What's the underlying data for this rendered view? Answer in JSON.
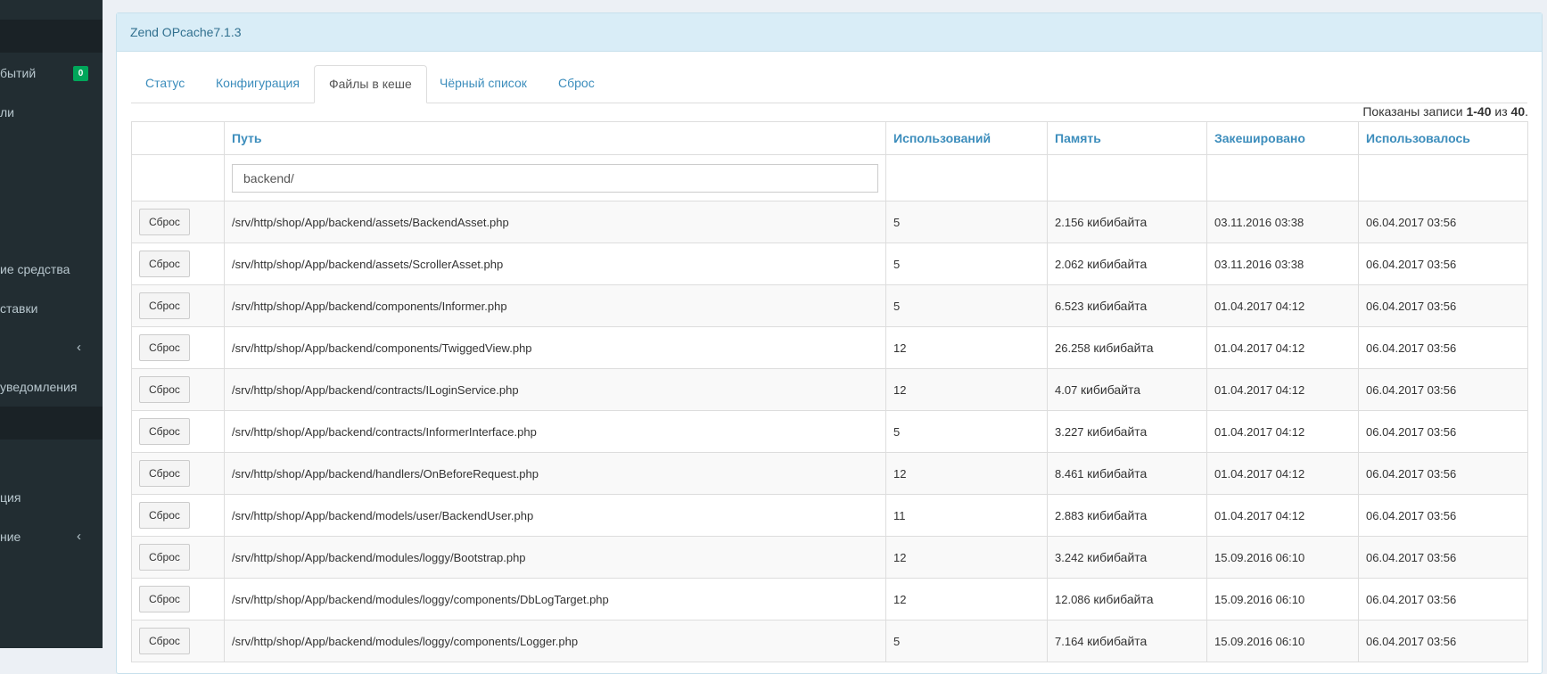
{
  "sidebar": {
    "items": [
      {
        "label": "бытий",
        "badge": "0"
      },
      {
        "label": "ли"
      },
      {
        "label": "ие средства"
      },
      {
        "label": "ставки"
      },
      {
        "label": ""
      },
      {
        "label": "уведомления"
      },
      {
        "label": "ция"
      },
      {
        "label": "ние"
      }
    ],
    "chevron": "‹"
  },
  "header": {
    "title": "Zend OPcache7.1.3"
  },
  "tabs": [
    {
      "label": "Статус"
    },
    {
      "label": "Конфигурация"
    },
    {
      "label": "Файлы в кеше"
    },
    {
      "label": "Чёрный список"
    },
    {
      "label": "Сброс"
    }
  ],
  "summary": {
    "prefix": "Показаны записи ",
    "range": "1-40",
    "mid": " из ",
    "total": "40",
    "suffix": "."
  },
  "table": {
    "columns": [
      "",
      "Путь",
      "Использований",
      "Память",
      "Закешировано",
      "Использовалось"
    ],
    "filter_value": "backend/",
    "reset_label": "Сброс",
    "rows": [
      {
        "path": "/srv/http/shop/App/backend/assets/BackendAsset.php",
        "uses": "5",
        "mem": "2.156",
        "unit": "кибибайта",
        "cached": "03.11.2016 03:38",
        "used": "06.04.2017 03:56"
      },
      {
        "path": "/srv/http/shop/App/backend/assets/ScrollerAsset.php",
        "uses": "5",
        "mem": "2.062",
        "unit": "кибибайта",
        "cached": "03.11.2016 03:38",
        "used": "06.04.2017 03:56"
      },
      {
        "path": "/srv/http/shop/App/backend/components/Informer.php",
        "uses": "5",
        "mem": "6.523",
        "unit": "кибибайта",
        "cached": "01.04.2017 04:12",
        "used": "06.04.2017 03:56"
      },
      {
        "path": "/srv/http/shop/App/backend/components/TwiggedView.php",
        "uses": "12",
        "mem": "26.258",
        "unit": "кибибайта",
        "cached": "01.04.2017 04:12",
        "used": "06.04.2017 03:56"
      },
      {
        "path": "/srv/http/shop/App/backend/contracts/ILoginService.php",
        "uses": "12",
        "mem": "4.07",
        "unit": "кибибайта",
        "cached": "01.04.2017 04:12",
        "used": "06.04.2017 03:56"
      },
      {
        "path": "/srv/http/shop/App/backend/contracts/InformerInterface.php",
        "uses": "5",
        "mem": "3.227",
        "unit": "кибибайта",
        "cached": "01.04.2017 04:12",
        "used": "06.04.2017 03:56"
      },
      {
        "path": "/srv/http/shop/App/backend/handlers/OnBeforeRequest.php",
        "uses": "12",
        "mem": "8.461",
        "unit": "кибибайта",
        "cached": "01.04.2017 04:12",
        "used": "06.04.2017 03:56"
      },
      {
        "path": "/srv/http/shop/App/backend/models/user/BackendUser.php",
        "uses": "11",
        "mem": "2.883",
        "unit": "кибибайта",
        "cached": "01.04.2017 04:12",
        "used": "06.04.2017 03:56"
      },
      {
        "path": "/srv/http/shop/App/backend/modules/loggy/Bootstrap.php",
        "uses": "12",
        "mem": "3.242",
        "unit": "кибибайта",
        "cached": "15.09.2016 06:10",
        "used": "06.04.2017 03:56"
      },
      {
        "path": "/srv/http/shop/App/backend/modules/loggy/components/DbLogTarget.php",
        "uses": "12",
        "mem": "12.086",
        "unit": "кибибайта",
        "cached": "15.09.2016 06:10",
        "used": "06.04.2017 03:56"
      },
      {
        "path": "/srv/http/shop/App/backend/modules/loggy/components/Logger.php",
        "uses": "5",
        "mem": "7.164",
        "unit": "кибибайта",
        "cached": "15.09.2016 06:10",
        "used": "06.04.2017 03:56"
      }
    ]
  }
}
